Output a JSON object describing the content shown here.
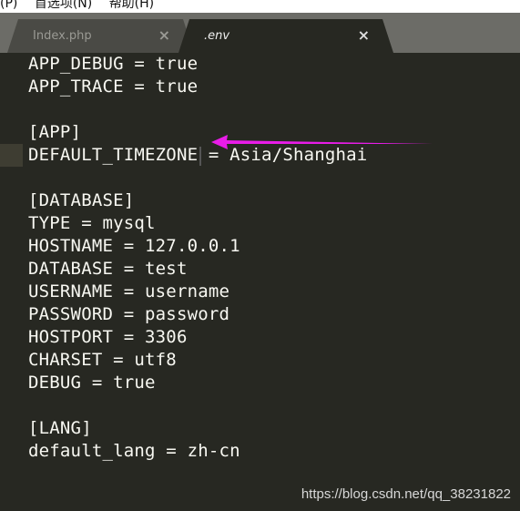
{
  "menu": [
    "(P)",
    "首选项(N)",
    "帮助(H)"
  ],
  "tabs": [
    {
      "label": "Index.php",
      "active": false
    },
    {
      "label": ".env",
      "active": true
    }
  ],
  "close_glyph": "×",
  "lines": [
    "APP_DEBUG = true",
    "APP_TRACE = true",
    "",
    "[APP]",
    "DEFAULT_TIMEZONE = Asia/Shanghai",
    "",
    "[DATABASE]",
    "TYPE = mysql",
    "HOSTNAME = 127.0.0.1",
    "DATABASE = test",
    "USERNAME = username",
    "PASSWORD = password",
    "HOSTPORT = 3306",
    "CHARSET = utf8",
    "DEBUG = true",
    "",
    "[LANG]",
    "default_lang = zh-cn"
  ],
  "annotation": {
    "type": "arrow",
    "points_to_line": 2,
    "color": "#e81ce8"
  },
  "watermark": "https://blog.csdn.net/qq_38231822"
}
